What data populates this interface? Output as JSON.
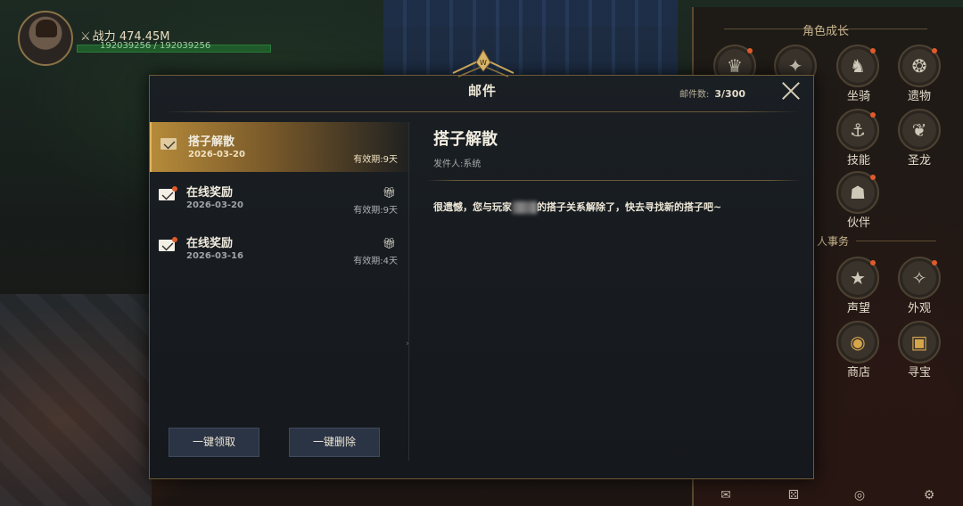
{
  "hud": {
    "power_label": "战力",
    "power_value": "474.45M",
    "hp_text": "192039256 / 192039256"
  },
  "side_panel": {
    "section1": "角色成长",
    "section2": "人事务",
    "items": [
      {
        "label": "坐骑",
        "icon": "mount-icon"
      },
      {
        "label": "遗物",
        "icon": "relic-icon"
      },
      {
        "label": "技能",
        "icon": "skill-icon"
      },
      {
        "label": "圣龙",
        "icon": "dragon-icon"
      },
      {
        "label": "伙伴",
        "icon": "partner-icon"
      },
      {
        "label": "声望",
        "icon": "reputation-icon"
      },
      {
        "label": "外观",
        "icon": "appearance-icon"
      },
      {
        "label": "商店",
        "icon": "shop-icon"
      },
      {
        "label": "寻宝",
        "icon": "treasure-icon"
      }
    ]
  },
  "mail": {
    "title": "邮件",
    "count_label": "邮件数:",
    "count_value": "3/300",
    "items": [
      {
        "title": "搭子解散",
        "date": "2026-03-20",
        "expiry": "有效期:9天",
        "has_gift": false
      },
      {
        "title": "在线奖励",
        "date": "2026-03-20",
        "expiry": "有效期:9天",
        "has_gift": true
      },
      {
        "title": "在线奖励",
        "date": "2026-03-16",
        "expiry": "有效期:4天",
        "has_gift": true
      }
    ],
    "claim_all": "一键领取",
    "delete_all": "一键删除",
    "detail": {
      "title": "搭子解散",
      "sender": "发件人:系统",
      "body_prefix": "很遗憾，您与玩家",
      "body_suffix": "的搭子关系解除了，快去寻找新的搭子吧~"
    }
  },
  "colors": {
    "accent_gold": "#b58a3a",
    "notify_red": "#e05a2a",
    "hp_green": "#1e5a2a"
  }
}
